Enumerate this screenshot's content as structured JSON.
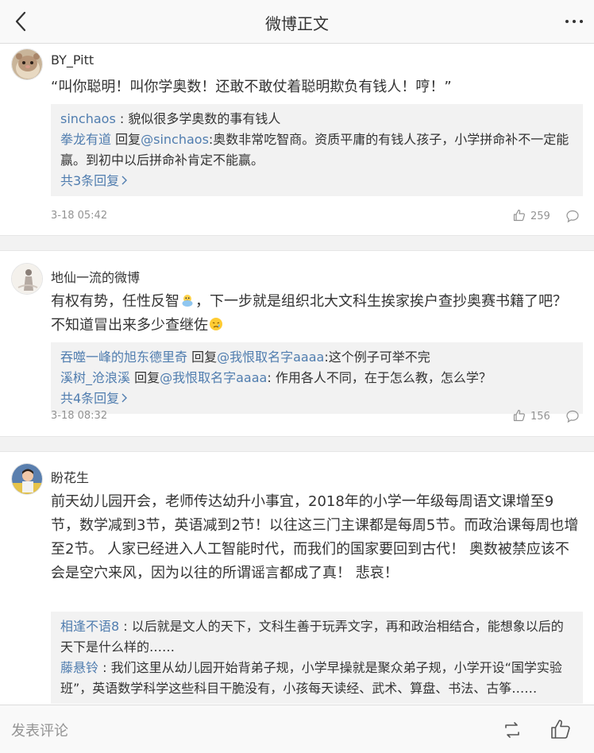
{
  "header": {
    "title": "微博正文",
    "back_icon": "chevron-left-icon",
    "more_icon": "more-dots-icon"
  },
  "comments": [
    {
      "user": "BY_Pitt",
      "text": "“叫你聪明！叫你学奥数！还敢不敢仗着聪明欺负有钱人！哼！”",
      "replies": [
        {
          "user": "sinchaos",
          "sep": " : ",
          "text": "貌似很多学奥数的事有钱人"
        },
        {
          "user": "拳龙有道",
          "verb": " 回复",
          "at": "@sinchaos",
          "text": ":奥数非常吃智商。资质平庸的有钱人孩子，小学拼命补不一定能赢。到初中以后拼命补肯定不能赢。"
        }
      ],
      "more_replies": "共3条回复",
      "time": "3-18 05:42",
      "likes": "259"
    },
    {
      "user": "地仙一流的微博",
      "text_a": "有权有势，任性反智",
      "text_b": "，下一步就是组织北大文科生挨家挨户查抄奥赛书籍了吧？不知道冒出来多少查继佐",
      "replies": [
        {
          "user": "吞噬一峰的旭东德里奇",
          "verb": " 回复",
          "at": "@我恨取名字aaaa",
          "text": ":这个例子可举不完"
        },
        {
          "user": "溪树_沧浪溪",
          "verb": " 回复",
          "at": "@我恨取名字aaaa",
          "text": ": 作用各人不同，在于怎么教，怎么学？"
        }
      ],
      "more_replies": "共4条回复",
      "time": "3-18 08:32",
      "likes": "156"
    },
    {
      "user": "盼花生",
      "text": "前天幼儿园开会，老师传达幼升小事宜，2018年的小学一年级每周语文课增至9节，数学减到3节，英语减到2节！以往这三门主课都是每周5节。而政治课每周也增至2节。 人家已经进入人工智能时代，而我们的国家要回到古代！ 奥数被禁应该不会是空穴来风，因为以往的所谓谣言都成了真！ 悲哀！",
      "replies": [
        {
          "user": "相逢不语8",
          "sep": " : ",
          "text": "以后就是文人的天下，文科生善于玩弄文字，再和政治相结合，能想象以后的天下是什么样的……"
        },
        {
          "user": "藤悬铃",
          "sep": " : ",
          "text": "我们这里从幼儿园开始背弟子规，小学早操就是聚众弟子规，小学开设“国学实验班”，英语数学科学这些科目干脆没有，小孩每天读经、武术、算盘、书法、古筝……"
        }
      ]
    }
  ],
  "footer": {
    "comment_placeholder": "发表评论",
    "repost_icon": "repost-icon",
    "like_icon": "thumbs-up-icon"
  },
  "colors": {
    "link": "#507daf",
    "meta": "#939393",
    "reply_bg": "#f2f2f2",
    "text": "#333333"
  }
}
